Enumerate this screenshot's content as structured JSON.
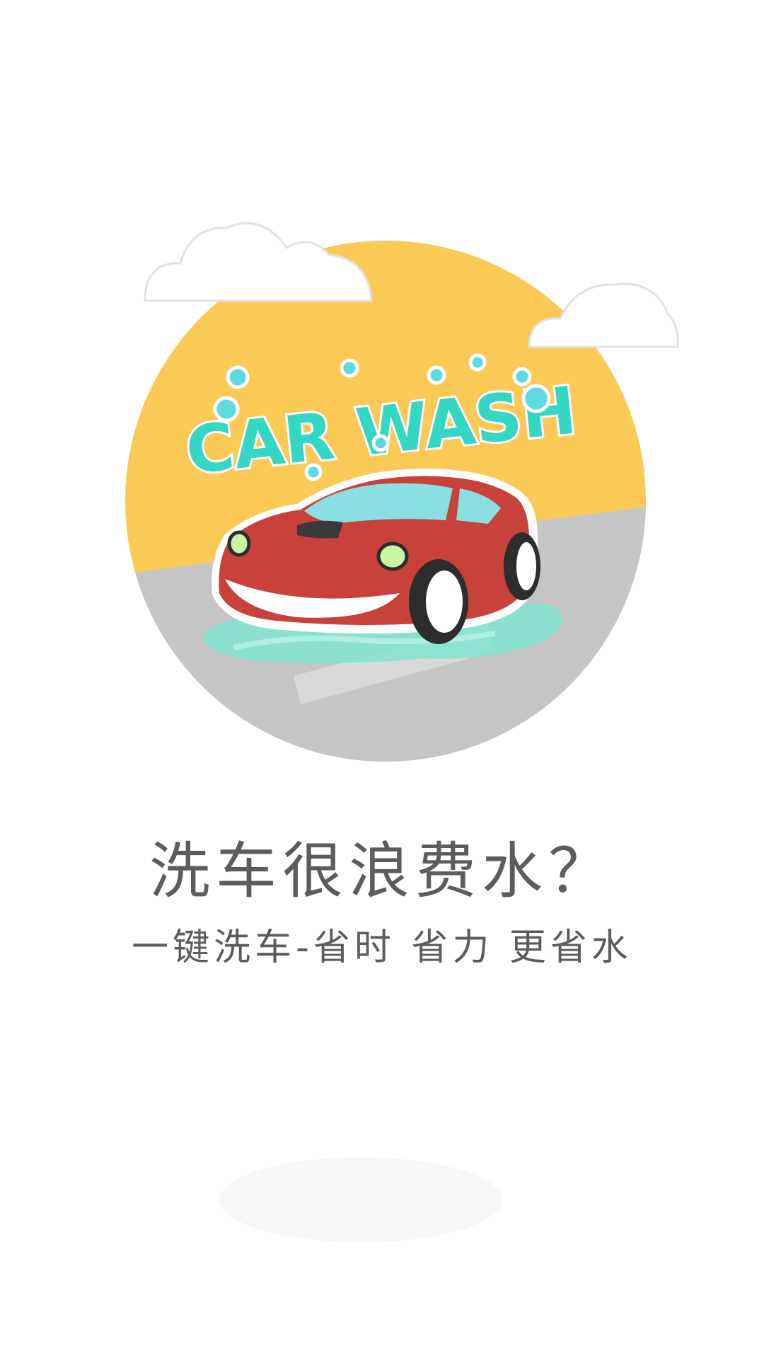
{
  "splash": {
    "logo_text": "CAR WASH",
    "headline": "洗车很浪费水？",
    "subline": "一键洗车-省时 省力 更省水"
  },
  "colors": {
    "sun": "#fbc955",
    "road": "#c5c5c5",
    "car_body": "#c8413a",
    "water": "#7fe3cf",
    "logo_text": "#34d6c4",
    "text": "#5c5c5c"
  },
  "icons": [
    "cloud-icon",
    "bubble-icon",
    "car-icon"
  ]
}
